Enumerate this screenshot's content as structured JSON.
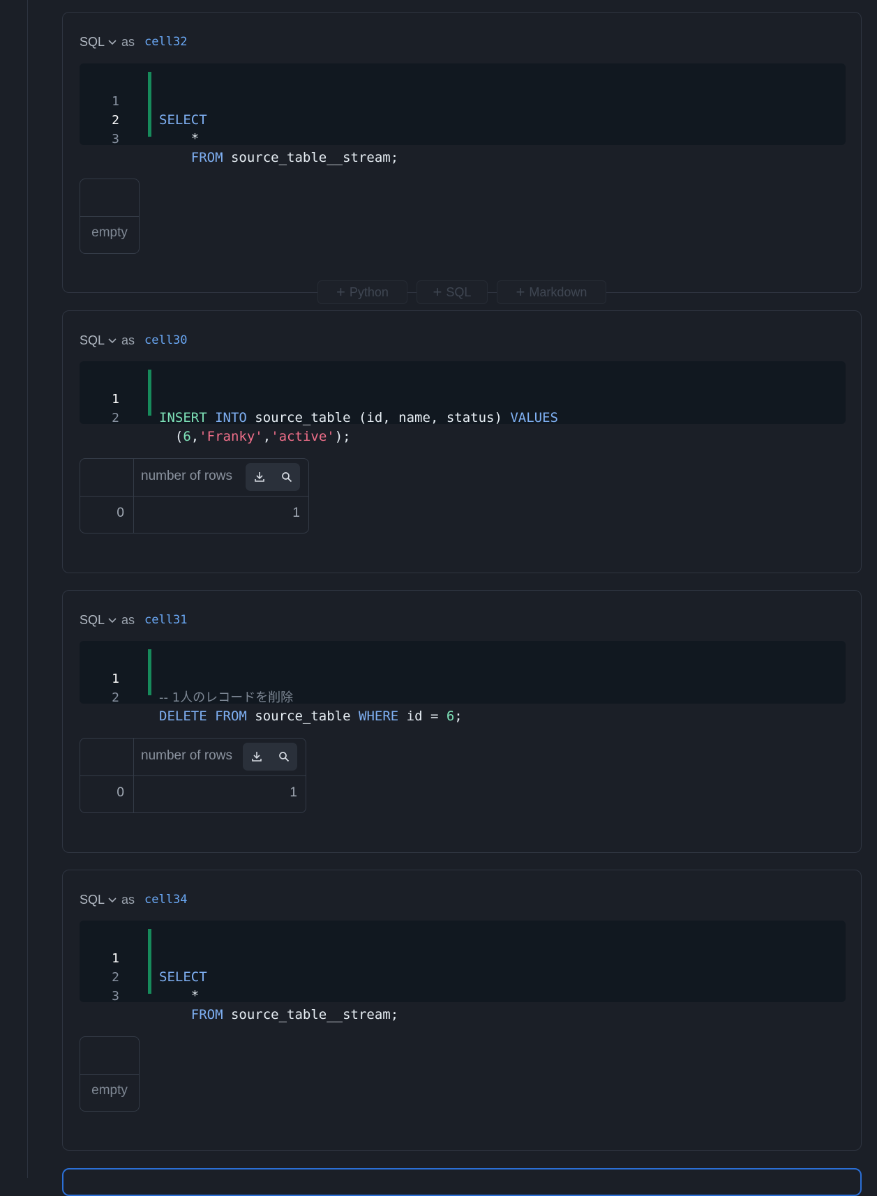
{
  "cells": [
    {
      "lang": "SQL",
      "as": "as",
      "name": "cell32",
      "lines": [
        {
          "n": "1",
          "active": false
        },
        {
          "n": "2",
          "active": true
        },
        {
          "n": "3",
          "active": false
        }
      ],
      "code": {
        "l1_kw": "SELECT",
        "l2": "    *",
        "l3_kw": "    FROM",
        "l3_rest": " source_table__stream;"
      },
      "result": {
        "kind": "empty",
        "label": "empty"
      }
    },
    {
      "lang": "SQL",
      "as": "as",
      "name": "cell30",
      "lines": [
        {
          "n": "1",
          "active": true
        },
        {
          "n": "2",
          "active": false
        }
      ],
      "code": {
        "l1_kw1": "INSERT",
        "l1_kw2": " INTO",
        "l1_rest": " source_table (id, name, status)",
        "l1_kw3": " VALUES",
        "l2_pre": "  (",
        "l2_num": "6",
        "l2_c1": ",",
        "l2_s1": "'Franky'",
        "l2_c2": ",",
        "l2_s2": "'active'",
        "l2_end": ");"
      },
      "result": {
        "kind": "table",
        "column": "number of rows",
        "index": "0",
        "value": "1"
      }
    },
    {
      "lang": "SQL",
      "as": "as",
      "name": "cell31",
      "lines": [
        {
          "n": "1",
          "active": true
        },
        {
          "n": "2",
          "active": false
        }
      ],
      "code": {
        "l1_comment": "-- 1人のレコードを削除",
        "l2_kw1": "DELETE",
        "l2_kw2": " FROM",
        "l2_mid": " source_table",
        "l2_kw3": " WHERE",
        "l2_rest": " id = ",
        "l2_num": "6",
        "l2_end": ";"
      },
      "result": {
        "kind": "table",
        "column": "number of rows",
        "index": "0",
        "value": "1"
      }
    },
    {
      "lang": "SQL",
      "as": "as",
      "name": "cell34",
      "lines": [
        {
          "n": "1",
          "active": true
        },
        {
          "n": "2",
          "active": false
        },
        {
          "n": "3",
          "active": false
        }
      ],
      "code": {
        "l1_kw": "SELECT",
        "l2": "    *",
        "l3_kw": "    FROM",
        "l3_rest": " source_table__stream;"
      },
      "result": {
        "kind": "empty",
        "label": "empty"
      }
    }
  ],
  "add_bar": {
    "python": "Python",
    "sql": "SQL",
    "markdown": "Markdown"
  },
  "colors": {
    "background": "#1b1f27",
    "editor_bg": "#111820",
    "keyword": "#7fb0f3",
    "keyword_insert": "#7ee2b8",
    "string": "#f06f8a",
    "cell_name": "#6aa8f5",
    "edit_bar": "#178a5b",
    "active_cell_border": "#2b6fd6"
  },
  "icons": [
    "chevron-down-icon",
    "download-icon",
    "search-icon",
    "plus-icon"
  ]
}
